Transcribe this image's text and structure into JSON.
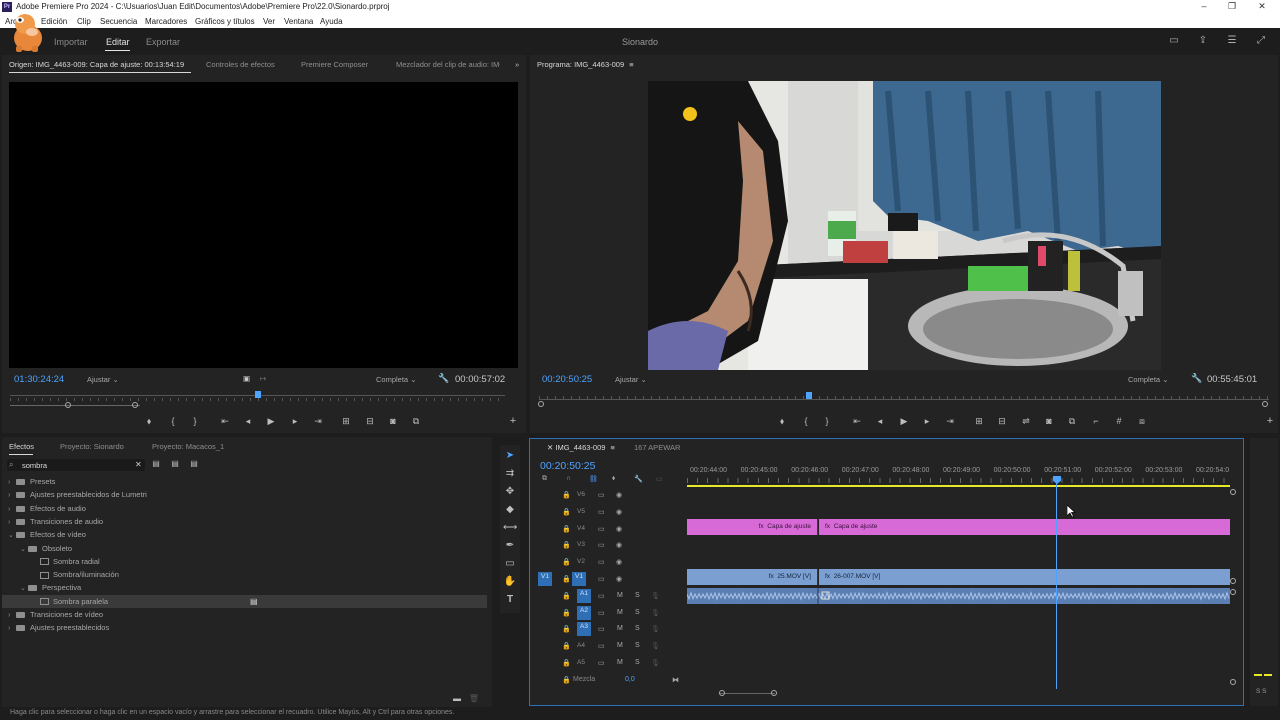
{
  "window": {
    "title": "Adobe Premiere Pro 2024 - C:\\Usuarios\\Juan Edit\\Documentos\\Adobe\\Premiere Pro\\22.0\\Sionardo.prproj",
    "minimize": "–",
    "maximize": "❐",
    "close": "✕"
  },
  "menu": [
    "Archivo",
    "Edición",
    "Clip",
    "Secuencia",
    "Marcadores",
    "Gráficos y títulos",
    "Ver",
    "Ventana",
    "Ayuda"
  ],
  "header": {
    "modes": [
      "Importar",
      "Editar",
      "Exportar"
    ],
    "active_mode": "Editar",
    "project_name": "Sionardo"
  },
  "source_panel": {
    "tabs": [
      "Origen: IMG_4463-009: Capa de ajuste: 00:13:54:19",
      "Controles de efectos",
      "Premiere Composer",
      "Mezclador del clip de audio: IMG"
    ],
    "menu_glyph": "≡",
    "timecode": "01:30:24:24",
    "fit": "Ajustar",
    "quality": "Completa",
    "duration": "00:00:57:02",
    "playhead_position": 0.5
  },
  "program_panel": {
    "tab": "Programa: IMG_4463-009",
    "menu_glyph": "≡",
    "timecode": "00:20:50:25",
    "fit": "Ajustar",
    "quality": "Completa",
    "duration": "00:55:45:01",
    "playhead_position": 0.37
  },
  "effects_panel": {
    "tabs": [
      "Efectos",
      "Proyecto: Sionardo",
      "Proyecto: Macacos_1"
    ],
    "search_value": "sombra",
    "tree": [
      {
        "label": "Presets",
        "type": "folder",
        "level": 0,
        "open": false
      },
      {
        "label": "Ajustes preestablecidos de Lumetri",
        "type": "folder",
        "level": 0,
        "open": false
      },
      {
        "label": "Efectos de audio",
        "type": "folder",
        "level": 0,
        "open": false
      },
      {
        "label": "Transiciones de audio",
        "type": "folder",
        "level": 0,
        "open": false
      },
      {
        "label": "Efectos de vídeo",
        "type": "folder",
        "level": 0,
        "open": true
      },
      {
        "label": "Obsoleto",
        "type": "folder",
        "level": 1,
        "open": true
      },
      {
        "label": "Sombra radial",
        "type": "effect",
        "level": 2
      },
      {
        "label": "Sombra/iluminación",
        "type": "effect",
        "level": 2
      },
      {
        "label": "Perspectiva",
        "type": "folder",
        "level": 1,
        "open": true
      },
      {
        "label": "Sombra paralela",
        "type": "effect",
        "level": 2,
        "selected": true
      },
      {
        "label": "Transiciones de vídeo",
        "type": "folder",
        "level": 0,
        "open": false
      },
      {
        "label": "Ajustes preestablecidos",
        "type": "folder",
        "level": 0,
        "open": false
      }
    ]
  },
  "timeline": {
    "tabs": [
      "IMG_4463-009",
      "167 APEWAR"
    ],
    "menu_glyph": "≡",
    "timecode": "00:20:50:25",
    "ruler": [
      "00:20:44:00",
      "00:20:45:00",
      "00:20:46:00",
      "00:20:47:00",
      "00:20:48:00",
      "00:20:49:00",
      "00:20:50:00",
      "00:20:51:00",
      "00:20:52:00",
      "00:20:53:00",
      "00:20:54:0"
    ],
    "video_tracks": [
      "V6",
      "V5",
      "V4",
      "V3",
      "V2",
      "V1"
    ],
    "audio_tracks": [
      "A1",
      "A2",
      "A3",
      "A4",
      "A5"
    ],
    "source_patch_video": "V1",
    "mute": "M",
    "solo": "S",
    "mix_label": "Mezcla",
    "mix_value": "0,0",
    "clips": {
      "adj1": "Capa de ajuste",
      "adj2": "Capa de ajuste",
      "vid1": "25.MOV [V]",
      "vid2": "26-007.MOV [V]",
      "fx": "fx"
    },
    "meter_label": "S S"
  },
  "status_bar": "Haga clic para seleccionar o haga clic en un espacio vacío y arrastre para seleccionar el recuadro. Utilice Mayús, Alt y Ctrl para otras opciones.",
  "colors": {
    "accent": "#4ea3ff",
    "adjustment": "#d86ad8",
    "video": "#7a9fd0",
    "audio": "#5b7fb3",
    "work_area": "#e8e82a"
  }
}
